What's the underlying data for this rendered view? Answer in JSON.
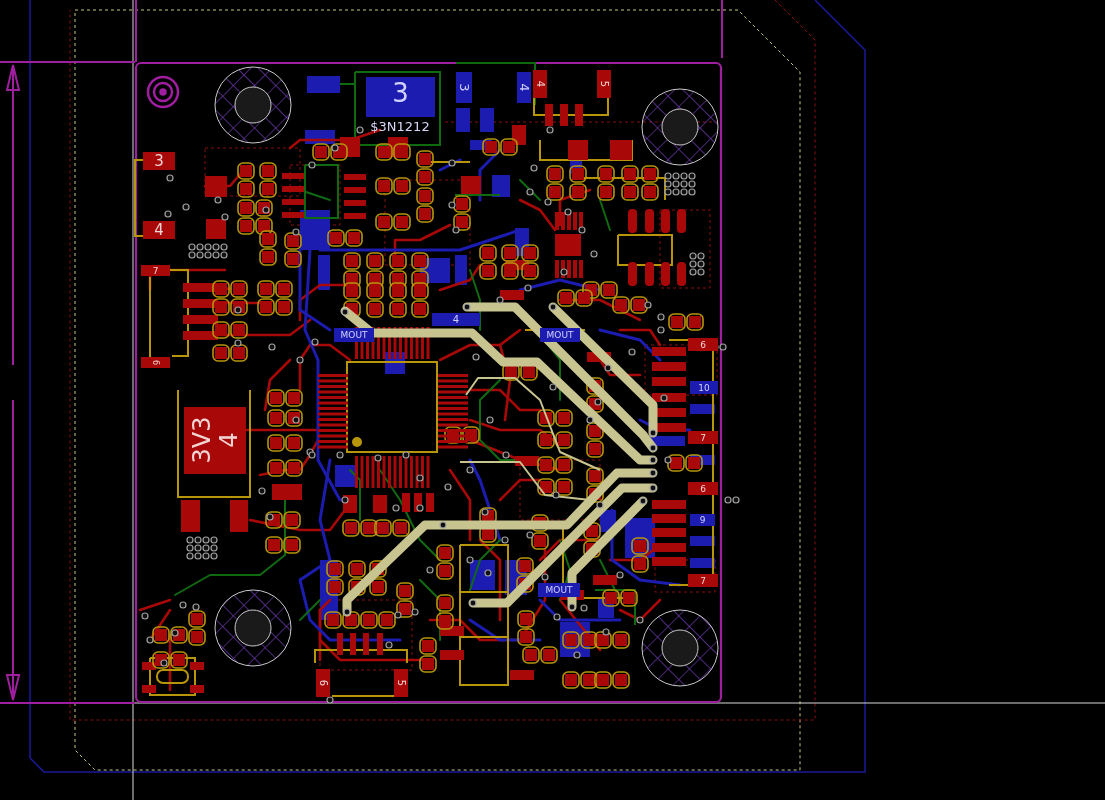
{
  "pads": [
    {
      "kind": "bottom_pad",
      "label": "3"
    },
    {
      "kind": "bottom_pad",
      "label": "3"
    },
    {
      "kind": "bottom_pad",
      "label": "4"
    },
    {
      "kind": "top_pad",
      "label": "4"
    },
    {
      "kind": "top_pad",
      "label": "5"
    },
    {
      "kind": "top_pad",
      "label": "3"
    },
    {
      "kind": "top_pad",
      "label": "4"
    },
    {
      "kind": "top_pad",
      "label": "7"
    },
    {
      "kind": "bottom_pad",
      "label": "4"
    },
    {
      "kind": "bottom_pad",
      "label": "MOUT"
    },
    {
      "kind": "bottom_pad",
      "label": "MOUT"
    },
    {
      "kind": "top_pad",
      "label": "6"
    },
    {
      "kind": "top_pad",
      "label": "6"
    },
    {
      "kind": "bottom_pad",
      "label": "10"
    },
    {
      "kind": "top_pad",
      "label": "7"
    },
    {
      "kind": "top_pad",
      "label": "6"
    },
    {
      "kind": "bottom_pad",
      "label": "9"
    },
    {
      "kind": "bottom_pad",
      "label": "MOUT"
    },
    {
      "kind": "top_pad",
      "label": "7"
    },
    {
      "kind": "top_pad",
      "label": "6"
    },
    {
      "kind": "top_pad",
      "label": "5"
    }
  ],
  "part_value": "$3N1212",
  "power_pad": {
    "net": "3V3",
    "pin": "4"
  }
}
